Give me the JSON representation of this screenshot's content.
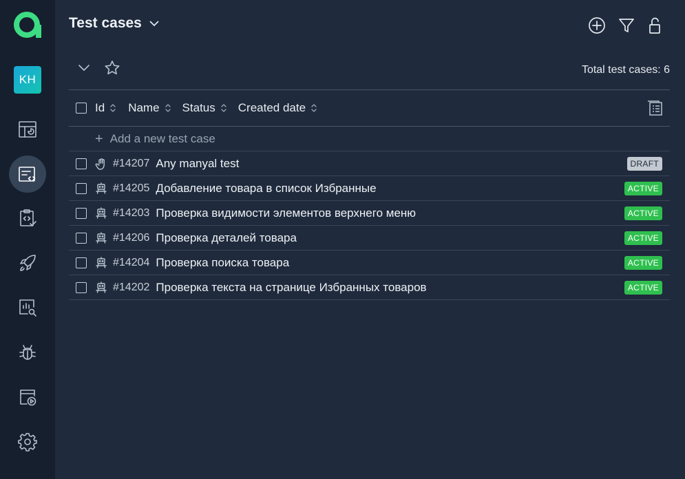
{
  "brand": {
    "logo_icon": "alpha-logo-icon",
    "colors": {
      "logo_green": "#3ddc84",
      "avatar": "#1aa6d9"
    }
  },
  "user": {
    "initials": "KH"
  },
  "sidebar": {
    "items": [
      {
        "name": "dashboard",
        "icon": "dashboard-icon",
        "active": false
      },
      {
        "name": "test-cases",
        "icon": "test-cases-icon",
        "active": true
      },
      {
        "name": "test-plans",
        "icon": "test-plans-icon",
        "active": false
      },
      {
        "name": "launches",
        "icon": "rocket-icon",
        "active": false
      },
      {
        "name": "analytics",
        "icon": "analytics-icon",
        "active": false
      },
      {
        "name": "defects",
        "icon": "bug-icon",
        "active": false
      },
      {
        "name": "runs",
        "icon": "run-icon",
        "active": false
      },
      {
        "name": "settings",
        "icon": "gear-icon",
        "active": false
      }
    ]
  },
  "header": {
    "title": "Test cases"
  },
  "toolbar": {
    "total_label": "Total test cases: 6"
  },
  "table": {
    "columns": {
      "id": "Id",
      "name": "Name",
      "status": "Status",
      "created": "Created date"
    },
    "add_label": "Add a new test case",
    "rows": [
      {
        "id": "#14207",
        "name": "Any manyal test",
        "type": "manual",
        "status": "DRAFT"
      },
      {
        "id": "#14205",
        "name": "Добавление товара в список Избранные",
        "type": "automated",
        "status": "ACTIVE"
      },
      {
        "id": "#14203",
        "name": "Проверка видимости элементов верхнего меню",
        "type": "automated",
        "status": "ACTIVE"
      },
      {
        "id": "#14206",
        "name": "Проверка деталей товара",
        "type": "automated",
        "status": "ACTIVE"
      },
      {
        "id": "#14204",
        "name": "Проверка поиска товара",
        "type": "automated",
        "status": "ACTIVE"
      },
      {
        "id": "#14202",
        "name": "Проверка текста на странице Избранных товаров",
        "type": "automated",
        "status": "ACTIVE"
      }
    ]
  },
  "colors": {
    "draft": "#c3c9d0",
    "active": "#2fbf4f"
  }
}
